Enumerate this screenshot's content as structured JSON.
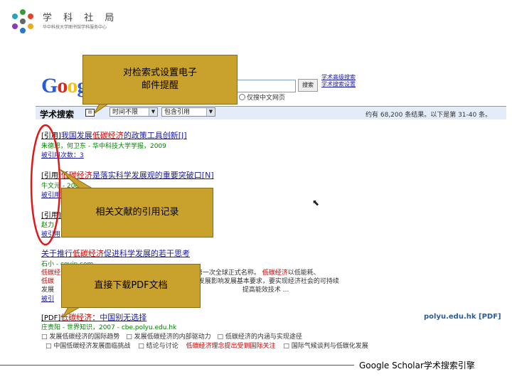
{
  "header": {
    "logo_title": "学 科 社 局",
    "logo_subtitle": "华中科技大学图书馆学科服务中心"
  },
  "google": {
    "logo_letters": [
      "G",
      "o",
      "o",
      "g",
      "l",
      "e"
    ],
    "logo_colors": [
      "#2a5bd7",
      "#d62d20",
      "#f4c20d",
      "#2a5bd7",
      "#1d9a4a",
      "#d62d20"
    ],
    "search_button": "搜索",
    "advanced_links": [
      "学术高级搜索",
      "学术搜索设置"
    ],
    "radio_label": "仅搜中文网页"
  },
  "results_bar": {
    "label": "学术搜索",
    "time_select": "时间不限",
    "type_select": "包含引用",
    "count_text": "约有 68,200 条结果。以下是第 31-40 条。"
  },
  "results": [
    {
      "tag": "[引用]",
      "title_pre": "我国发展",
      "title_hl": "低碳经济",
      "title_post": "的政策工具创新[J]",
      "meta": "朱德思，何卫东 - 华中科技大学学报，2009",
      "cite": "被引用次数：3"
    },
    {
      "tag": "[引用]",
      "title_pre": "",
      "title_hl": "低碳经济",
      "title_post": "是落实科学发展观的重要突破口[N]",
      "meta": "牛文元 - 2009",
      "cite": "被引用次数"
    },
    {
      "tag": "[引用]",
      "title_pre": "",
      "title_hl": "",
      "title_post": "",
      "meta": "赵力",
      "cite": "被引用"
    },
    {
      "tag": "",
      "title_pre": "关于推行",
      "title_hl": "低碳经济",
      "title_post": "促进科学发展的若干思考",
      "meta": "石小 - cqvip.com",
      "snippet_1_hl": "低碳经济",
      "snippet_1": "的第一次全球正式名称。",
      "snippet_1b_hl": "低碳经济",
      "snippet_1b": "以低能耗、",
      "snippet_2_hl": "低碳",
      "snippet_2": "发展影响发展基本要求，要实现经济社会的可持续",
      "snippet_3": "发展",
      "snippet_3b": "提高能效技术 ...",
      "cite": "被引"
    },
    {
      "tag": "[PDF]",
      "title_pre": "",
      "title_hl": "低碳经济",
      "title_post": "：中国别无选择",
      "meta": "庄贵阳 - 世界知识，2007 - cbe.polyu.edu.hk",
      "side_domain": "polyu.edu.hk [PDF]",
      "related": [
        "□ 发展低碳经济的国际趋势",
        "□ 发展低碳经济的内部驱动力",
        "□ 低碳经济的内涵与实现途径",
        "□ 中国低碳经济发展面临挑战",
        "□ 结论与讨论",
        "低碳经济理念提出受到国际关注",
        "□ 国际气候谈判与低碳化发展"
      ]
    }
  ],
  "callouts": {
    "email_alert": "对检索式设置电子邮件提醒",
    "citation_record": "相关文献的引用记录",
    "pdf_download": "直接下载PDF文档"
  },
  "footer": {
    "text": "Google Scholar学术搜索引擎"
  }
}
